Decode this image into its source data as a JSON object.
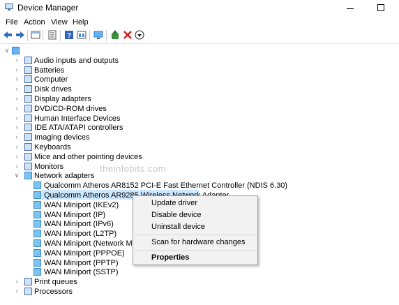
{
  "window": {
    "title": "Device Manager"
  },
  "menu": [
    "File",
    "Action",
    "View",
    "Help"
  ],
  "toolbar_icons": [
    "back-icon",
    "forward-icon",
    "show-hide-icon",
    "properties-icon",
    "help-icon",
    "view-icon",
    "monitor-icon",
    "update-driver-icon",
    "uninstall-icon",
    "download-icon"
  ],
  "tree": {
    "categories": [
      "Audio inputs and outputs",
      "Batteries",
      "Computer",
      "Disk drives",
      "Display adapters",
      "DVD/CD-ROM drives",
      "Human Interface Devices",
      "IDE ATA/ATAPI controllers",
      "Imaging devices",
      "Keyboards",
      "Mice and other pointing devices",
      "Monitors",
      "Network adapters"
    ],
    "network_children": [
      "Qualcomm Atheros AR8152 PCI-E Fast Ethernet Controller (NDIS 6.30)",
      "Qualcomm Atheros AR9285 Wireless Network Adapter",
      "WAN Miniport (IKEv2)",
      "WAN Miniport (IP)",
      "WAN Miniport (IPv6)",
      "WAN Miniport (L2TP)",
      "WAN Miniport (Network Monitor)",
      "WAN Miniport (PPPOE)",
      "WAN Miniport (PPTP)",
      "WAN Miniport (SSTP)"
    ],
    "after": [
      "Print queues",
      "Processors"
    ]
  },
  "watermark": "theinfobits.com",
  "context_menu": {
    "update": "Update driver",
    "disable": "Disable device",
    "uninstall": "Uninstall device",
    "scan": "Scan for hardware changes",
    "properties": "Properties"
  }
}
